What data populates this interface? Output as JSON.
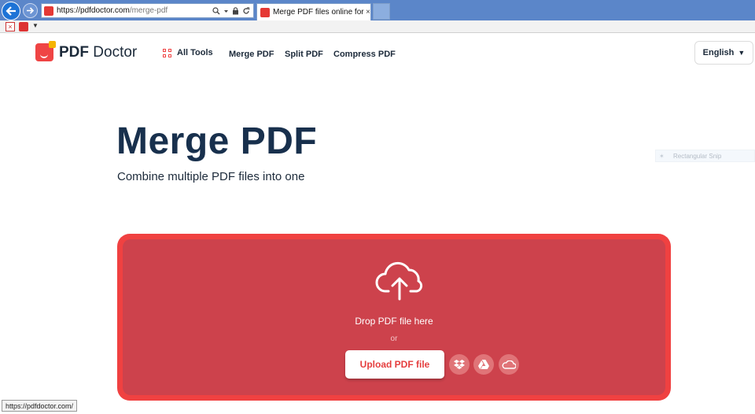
{
  "browser": {
    "url_host": "https://pdfdoctor.com",
    "url_path": "/merge-pdf",
    "tab_title": "Merge PDF files online for f...",
    "tab_close": "×",
    "status_url": "https://pdfdoctor.com/"
  },
  "header": {
    "logo_bold": "PDF",
    "logo_rest": " Doctor",
    "nav": {
      "all_tools": "All Tools",
      "merge": "Merge PDF",
      "split": "Split PDF",
      "compress": "Compress PDF"
    },
    "language": "English"
  },
  "hero": {
    "title": "Merge PDF",
    "subtitle": "Combine multiple PDF files into one"
  },
  "overlay": {
    "snip_label": "Rectangular Snip"
  },
  "dropzone": {
    "drop_text": "Drop PDF file here",
    "or_text": "or",
    "upload_label": "Upload PDF file",
    "sources": [
      "dropbox-icon",
      "google-drive-icon",
      "onedrive-icon"
    ]
  },
  "colors": {
    "brand_red": "#f04141",
    "dropzone_inner": "#cd424c",
    "title_navy": "#18304d"
  }
}
